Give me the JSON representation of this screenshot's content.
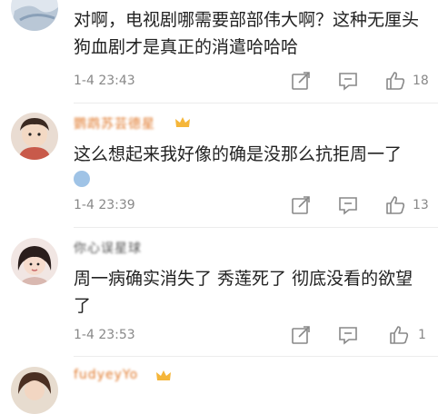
{
  "comments": [
    {
      "text": "对啊，电视剧哪需要部部伟大啊？这种无厘头狗血剧才是真正的消遣哈哈哈",
      "time": "1-4 23:43",
      "likes": "18"
    },
    {
      "username": "鹦鹉苏芸德星",
      "text": "这么想起来我好像的确是没那么抗拒周一了",
      "time": "1-4 23:39",
      "likes": "13"
    },
    {
      "username": "你心误星球",
      "text": "周一病确实消失了 秀莲死了 彻底没看的欲望了",
      "time": "1-4 23:53",
      "likes": "1"
    },
    {
      "username": "fudyeyYo"
    }
  ]
}
